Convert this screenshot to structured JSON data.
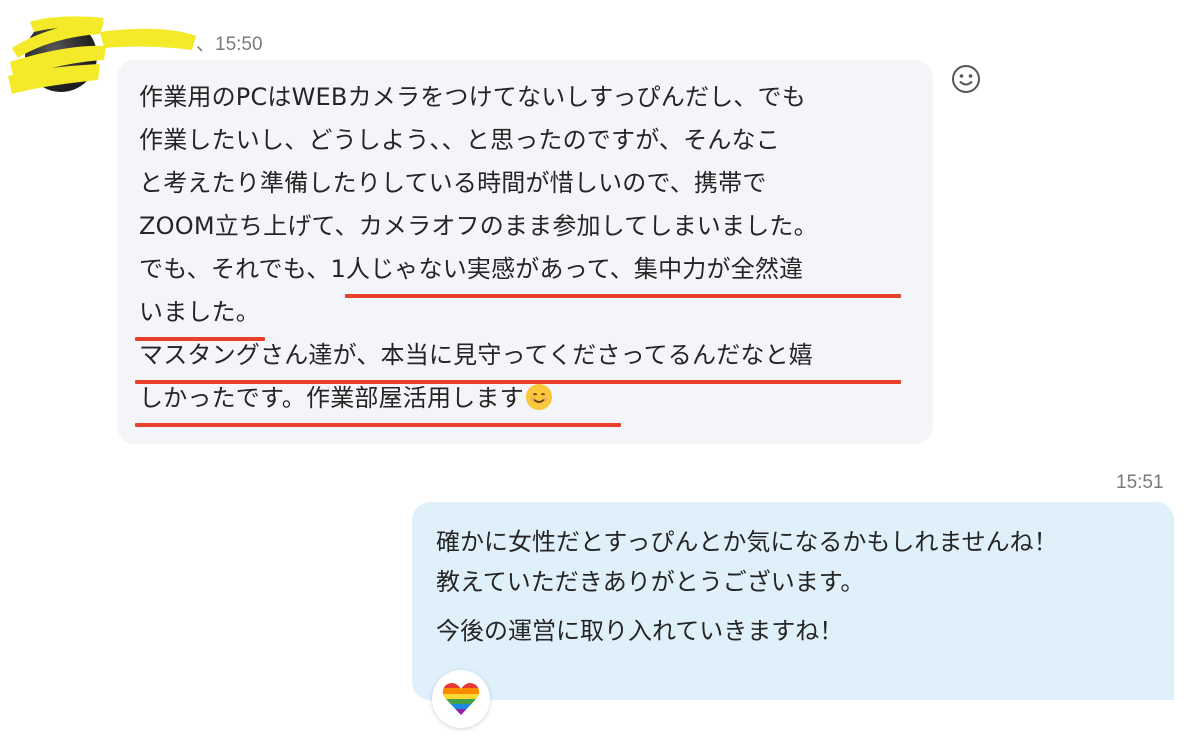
{
  "incoming": {
    "sender_suffix": "、15:50",
    "lines": [
      "作業用のPCはWEBカメラをつけてないしすっぴんだし、でも",
      "作業したいし、どうしよう、、と思ったのですが、そんなこ",
      "と考えたり準備したりしている時間が惜しいので、携帯で",
      "ZOOM立ち上げて、カメラオフのまま参加してしまいました。",
      "でも、それでも、1人じゃない実感があって、集中力が全然違",
      "いました。",
      "マスタングさん達が、本当に見守ってくださってるんだなと嬉",
      "しかったです。作業部屋活用します"
    ],
    "react_icon": "smiley-icon",
    "underline_color": "#e8402a"
  },
  "outgoing": {
    "time": "15:51",
    "lines": [
      "確かに女性だとすっぴんとか気になるかもしれませんね！",
      "教えていただきありがとうございます。",
      "今後の運営に取り入れていきますね！"
    ],
    "reaction_icon": "rainbow-heart-icon"
  },
  "colors": {
    "incoming_bubble": "#f3f5f8",
    "outgoing_bubble": "#dff0fb",
    "redaction_yellow": "#f5ea2a",
    "timestamp": "#7a7a7a"
  }
}
